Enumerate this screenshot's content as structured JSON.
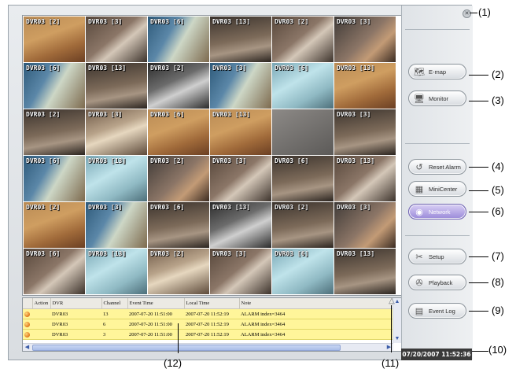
{
  "grid": {
    "cells": [
      {
        "label": "DVR03 [2]",
        "tone": "c-a"
      },
      {
        "label": "DVR03 [3]",
        "tone": "c-b"
      },
      {
        "label": "DVR03 [6]",
        "tone": "c-c"
      },
      {
        "label": "DVR03 [13]",
        "tone": "c-d"
      },
      {
        "label": "DVR03 [2]",
        "tone": "c-b"
      },
      {
        "label": "DVR03 [3]",
        "tone": "c-f"
      },
      {
        "label": "DVR03 [6]",
        "tone": "c-c"
      },
      {
        "label": "DVR03 [13]",
        "tone": "c-d"
      },
      {
        "label": "DVR03 [2]",
        "tone": "c-h"
      },
      {
        "label": "DVR03 [3]",
        "tone": "c-c"
      },
      {
        "label": "DVR03 [6]",
        "tone": "c-e"
      },
      {
        "label": "DVR03 [13]",
        "tone": "c-a"
      },
      {
        "label": "DVR03 [2]",
        "tone": "c-d"
      },
      {
        "label": "DVR03 [3]",
        "tone": "c-i"
      },
      {
        "label": "DVR03 [6]",
        "tone": "c-a"
      },
      {
        "label": "DVR03 [13]",
        "tone": "c-a"
      },
      {
        "label": "",
        "tone": "c-g"
      },
      {
        "label": "DVR03 [3]",
        "tone": "c-d"
      },
      {
        "label": "DVR03 [6]",
        "tone": "c-c"
      },
      {
        "label": "DVR03 [13]",
        "tone": "c-e"
      },
      {
        "label": "DVR03 [2]",
        "tone": "c-f"
      },
      {
        "label": "DVR03 [3]",
        "tone": "c-b"
      },
      {
        "label": "DVR03 [6]",
        "tone": "c-d"
      },
      {
        "label": "DVR03 [13]",
        "tone": "c-b"
      },
      {
        "label": "DVR03 [2]",
        "tone": "c-a"
      },
      {
        "label": "DVR03 [3]",
        "tone": "c-c"
      },
      {
        "label": "DVR03 [6]",
        "tone": "c-d"
      },
      {
        "label": "DVR03 [13]",
        "tone": "c-h"
      },
      {
        "label": "DVR03 [2]",
        "tone": "c-d"
      },
      {
        "label": "DVR03 [3]",
        "tone": "c-f"
      },
      {
        "label": "DVR03 [6]",
        "tone": "c-b"
      },
      {
        "label": "DVR03 [13]",
        "tone": "c-e"
      },
      {
        "label": "DVR03 [2]",
        "tone": "c-i"
      },
      {
        "label": "DVR03 [3]",
        "tone": "c-b"
      },
      {
        "label": "DVR03 [6]",
        "tone": "c-e"
      },
      {
        "label": "DVR03 [13]",
        "tone": "c-d"
      }
    ]
  },
  "event_table": {
    "headers": [
      "",
      "Action",
      "DVR",
      "Channel",
      "Event Time",
      "Local Time",
      "Note"
    ],
    "rows": [
      {
        "dvr": "DVR03",
        "channel": "13",
        "event_time": "2007-07-20 11:51:00",
        "local_time": "2007-07-20 11:52:19",
        "note": "ALARM index=3464"
      },
      {
        "dvr": "DVR03",
        "channel": "6",
        "event_time": "2007-07-20 11:51:00",
        "local_time": "2007-07-20 11:52:19",
        "note": "ALARM index=3464"
      },
      {
        "dvr": "DVR03",
        "channel": "3",
        "event_time": "2007-07-20 11:51:00",
        "local_time": "2007-07-20 11:52:19",
        "note": "ALARM index=3464"
      }
    ]
  },
  "sidebar": {
    "buttons": {
      "emap": "E-map",
      "monitor": "Monitor",
      "reset_alarm": "Reset Alarm",
      "minicenter": "MiniCenter",
      "network": "Network",
      "setup": "Setup",
      "playback": "Playback",
      "event_log": "Event Log"
    },
    "clock": "07/20/2007 11:52:36"
  },
  "callouts": {
    "c1": "(1)",
    "c2": "(2)",
    "c3": "(3)",
    "c4": "(4)",
    "c5": "(5)",
    "c6": "(6)",
    "c7": "(7)",
    "c8": "(8)",
    "c9": "(9)",
    "c10": "(10)",
    "c11": "(11)",
    "c12": "(12)"
  },
  "colors": {
    "log_row": "#fff59a",
    "network_button": "#9a8ad9",
    "clock_bg": "#3a3a3a"
  }
}
